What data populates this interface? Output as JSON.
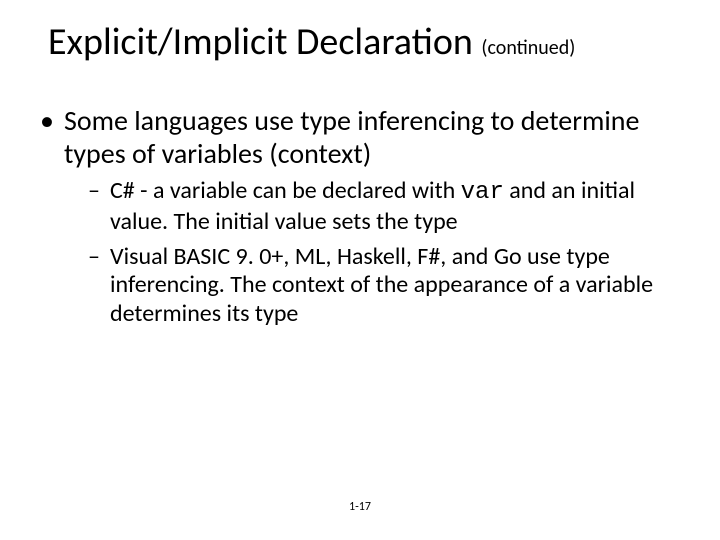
{
  "title": {
    "main": "Explicit/Implicit Declaration ",
    "suffix": "(continued)"
  },
  "bullets": {
    "b1": "Some languages use type inferencing to determine types of variables (context)",
    "b1_sub": {
      "s1_a": "C# - a variable can be declared with ",
      "s1_code": "var",
      "s1_b": " and an initial value. The initial value sets the type",
      "s2": "Visual BASIC 9. 0+, ML, Haskell, F#, and Go use type inferencing. The context of the appearance of a variable determines its type"
    }
  },
  "footer": "1-17"
}
